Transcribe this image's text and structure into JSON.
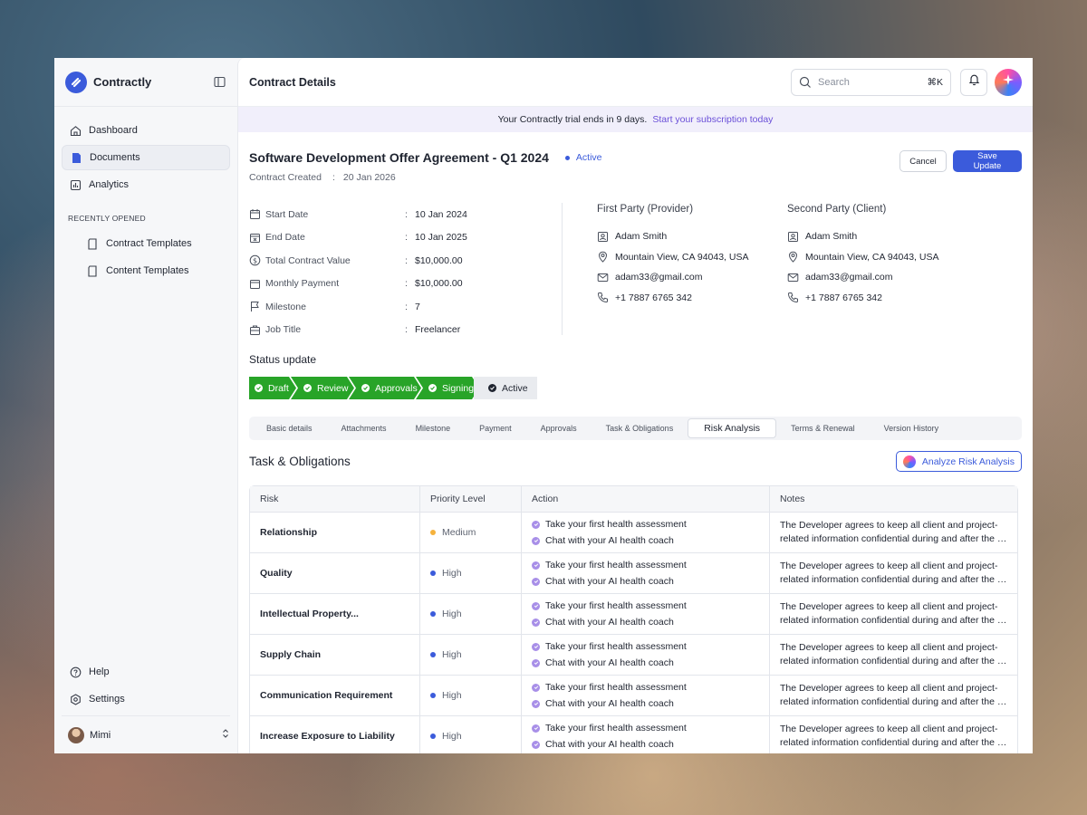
{
  "sidebar": {
    "brand": "Contractly",
    "nav": [
      {
        "label": "Dashboard",
        "icon": "home-icon"
      },
      {
        "label": "Documents",
        "icon": "document-icon",
        "active": true
      },
      {
        "label": "Analytics",
        "icon": "analytics-icon"
      }
    ],
    "recent_label": "RECENTLY OPENED",
    "recent": [
      {
        "label": "Contract Templates"
      },
      {
        "label": "Content Templates"
      }
    ],
    "help": "Help",
    "settings": "Settings",
    "user": "Mimi"
  },
  "header": {
    "title": "Contract Details",
    "search_placeholder": "Search",
    "search_shortcut": "⌘K"
  },
  "banner": {
    "text": "Your Contractly trial ends in 9 days.",
    "link": "Start your subscription today"
  },
  "contract": {
    "title": "Software Development Offer Agreement - Q1 2024",
    "status": "Active",
    "created_label": "Contract Created",
    "created_sep": ":",
    "created_date": "20 Jan 2026",
    "cancel": "Cancel",
    "save": "Save Update",
    "details": [
      {
        "label": "Start Date",
        "value": "10 Jan 2024"
      },
      {
        "label": "End Date",
        "value": "10 Jan 2025"
      },
      {
        "label": "Total Contract Value",
        "value": "$10,000.00"
      },
      {
        "label": "Monthly Payment",
        "value": "$10,000.00"
      },
      {
        "label": "Milestone",
        "value": "7"
      },
      {
        "label": "Job Title",
        "value": "Freelancer"
      }
    ],
    "colon": ":",
    "first_party": {
      "title": "First Party (Provider)",
      "name": "Adam Smith",
      "address": "Mountain View, CA 94043, USA",
      "email": "adam33@gmail.com",
      "phone": "+1 7887 6765 342"
    },
    "second_party": {
      "title": "Second Party (Client)",
      "name": "Adam Smith",
      "address": "Mountain View, CA 94043, USA",
      "email": "adam33@gmail.com",
      "phone": "+1 7887 6765 342"
    }
  },
  "status_update": {
    "label": "Status update",
    "steps": [
      "Draft",
      "Review",
      "Approvals",
      "Signing",
      "Active"
    ]
  },
  "tabs": [
    "Basic details",
    "Attachments",
    "Milestone",
    "Payment",
    "Approvals",
    "Task & Obligations",
    "Risk Analysis",
    "Terms & Renewal",
    "Version History"
  ],
  "active_tab": "Risk Analysis",
  "tasks": {
    "title": "Task & Obligations",
    "analyze_button": "Analyze Risk Analysis",
    "columns": [
      "Risk",
      "Priority Level",
      "Action",
      "Notes"
    ],
    "action_1": "Take your first health assessment",
    "action_2": "Chat with your AI health coach",
    "note_1": "The Developer agrees to keep all client and project-",
    "note_2": "related information confidential during and after the te...",
    "rows": [
      {
        "risk": "Relationship",
        "priority": "Medium",
        "priority_color": "#f5b23d"
      },
      {
        "risk": "Quality",
        "priority": "High",
        "priority_color": "#3b5bdb"
      },
      {
        "risk": "Intellectual Property...",
        "priority": "High",
        "priority_color": "#3b5bdb"
      },
      {
        "risk": "Supply Chain",
        "priority": "High",
        "priority_color": "#3b5bdb"
      },
      {
        "risk": "Communication Requirement",
        "priority": "High",
        "priority_color": "#3b5bdb"
      },
      {
        "risk": "Increase Exposure to Liability",
        "priority": "High",
        "priority_color": "#3b5bdb"
      }
    ]
  },
  "colors": {
    "accent": "#3b5bdb",
    "step_done": "#28a428",
    "banner_bg": "#f1effb"
  }
}
